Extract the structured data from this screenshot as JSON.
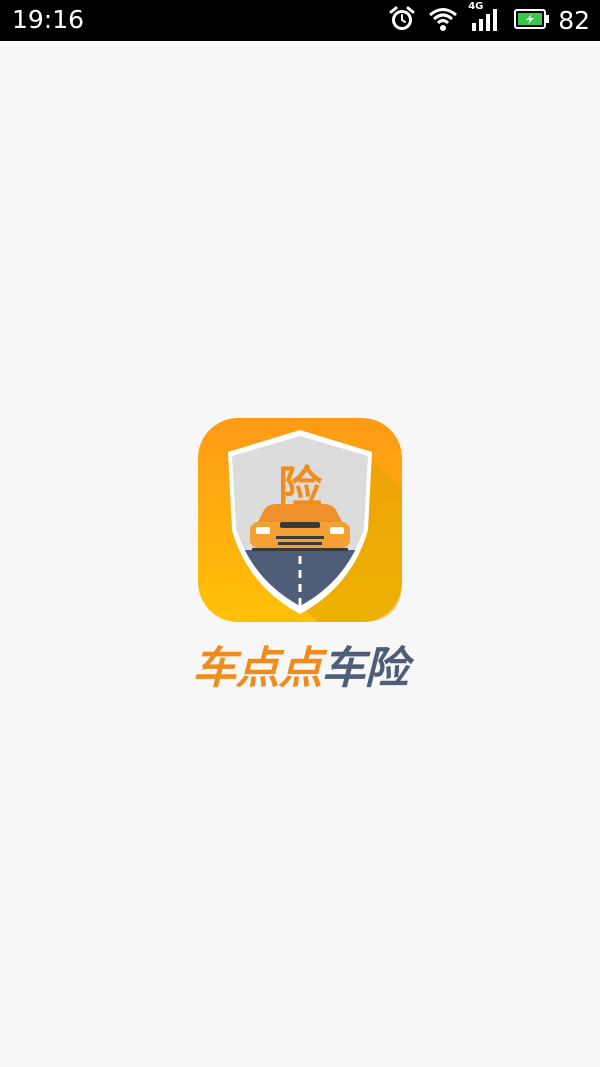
{
  "status_bar": {
    "time": "19:16",
    "battery": "82",
    "network": "4G",
    "icons": [
      "alarm-icon",
      "wifi-icon",
      "cellular-signal-icon",
      "battery-charging-icon"
    ]
  },
  "splash": {
    "icon_label": "险",
    "brand_part1": "车点点",
    "brand_part2": "车险",
    "colors": {
      "orange": "#f08c1c",
      "yellow": "#ffc107",
      "slate": "#4f5e78",
      "background": "#f7f7f7"
    }
  }
}
